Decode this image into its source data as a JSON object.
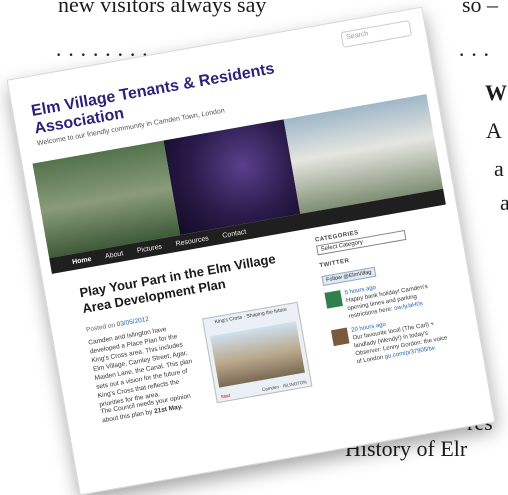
{
  "background": {
    "line_top_left": "new visitors always say",
    "line_top_right": "so –",
    "heading_w": "W",
    "line_a1": "A",
    "line_a2": "a",
    "line_a3": "a",
    "line_res": "res",
    "bullet_symbol": "•",
    "bullet_text": "History of Elr"
  },
  "card": {
    "search_placeholder": "Search",
    "site_title": "Elm Village Tenants & Residents Association",
    "tagline": "Welcome to our friendly community in Camden Town, London",
    "nav": [
      "Home",
      "About",
      "Pictures",
      "Resources",
      "Contact"
    ],
    "post_title": "Play Your Part in the Elm Village Area Development Plan",
    "posted_prefix": "Posted on",
    "posted_date": "03/05/2012",
    "body_p1": "Camden and Islington have developed a Place Plan for the King's Cross area. This includes Elm Village, Camley Street, Agar, Maiden Lane, the Canal. This plan sets out a vision for the future of King's Cross that reflects the priorities for the area.",
    "body_p2_text": "The Council needs your opinion about this plan by",
    "body_p2_date": "21st May.",
    "image_caption": "King's Cross · Shaping the future",
    "image_footer_left": "Start",
    "image_footer_right": "Camden · ISLINGTON",
    "categories_heading": "CATEGORIES",
    "categories_select": "Select Category",
    "twitter_heading": "TWITTER",
    "follow_label": "Follow @ElmVillag",
    "tweets": [
      {
        "time": "5 hours ago",
        "text": "Happy bank holiday! Camden's opening times and parking restrictions here:",
        "link": "ow.ly/aH0s"
      },
      {
        "time": "20 hours ago",
        "text": "Our favourite local (The Carl) + landlady (Wendy!) in today's Observer: Lenny Gordon: the voice of London",
        "link": "gu.com/p/37905/tw"
      }
    ]
  }
}
